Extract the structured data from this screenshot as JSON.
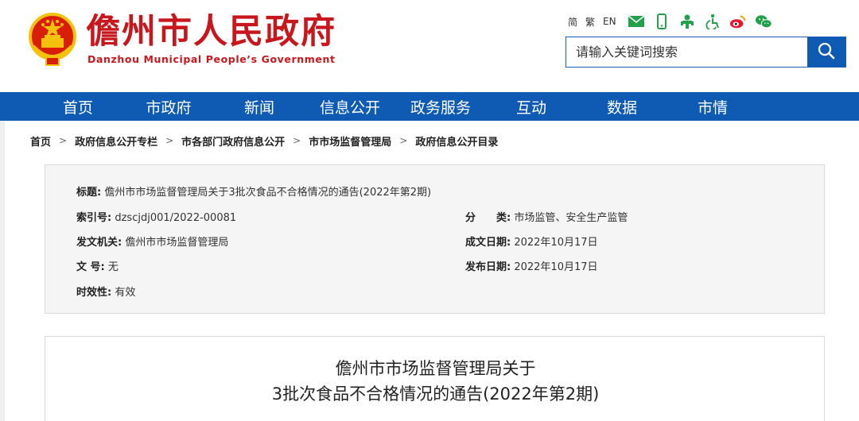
{
  "header": {
    "site_name": "儋州市人民政府",
    "site_subtitle": "Danzhou Municipal People’s Government",
    "tools": {
      "simplified": "简",
      "traditional": "繁",
      "english": "EN"
    },
    "search": {
      "placeholder": "请输入关键词搜索"
    },
    "colors": {
      "brand_red": "#c8161d",
      "nav_blue": "#0f5bb4"
    }
  },
  "nav": {
    "items": [
      "首页",
      "市政府",
      "新闻",
      "信息公开",
      "政务服务",
      "互动",
      "数据",
      "市情"
    ]
  },
  "breadcrumb": [
    "首页",
    "政府信息公开专栏",
    "市各部门政府信息公开",
    "市市场监督管理局",
    "政府信息公开目录"
  ],
  "info": {
    "title_label": "标题:",
    "title_value": "儋州市市场监督管理局关于3批次食品不合格情况的通告(2022年第2期)",
    "index_label": "索引号:",
    "index_value": "dzscjdj001/2022-00081",
    "category_label": "分　　类:",
    "category_value": "市场监管、安全生产监管",
    "issuer_label": "发文机关:",
    "issuer_value": "儋州市市场监督管理局",
    "created_label": "成文日期:",
    "created_value": "2022年10月17日",
    "docno_label": "文  号:",
    "docno_value": "无",
    "published_label": "发布日期:",
    "published_value": "2022年10月17日",
    "validity_label": "时效性:",
    "validity_value": "有效"
  },
  "article": {
    "title_line1": "儋州市市场监督管理局关于",
    "title_line2": "3批次食品不合格情况的通告(2022年第2期)"
  }
}
